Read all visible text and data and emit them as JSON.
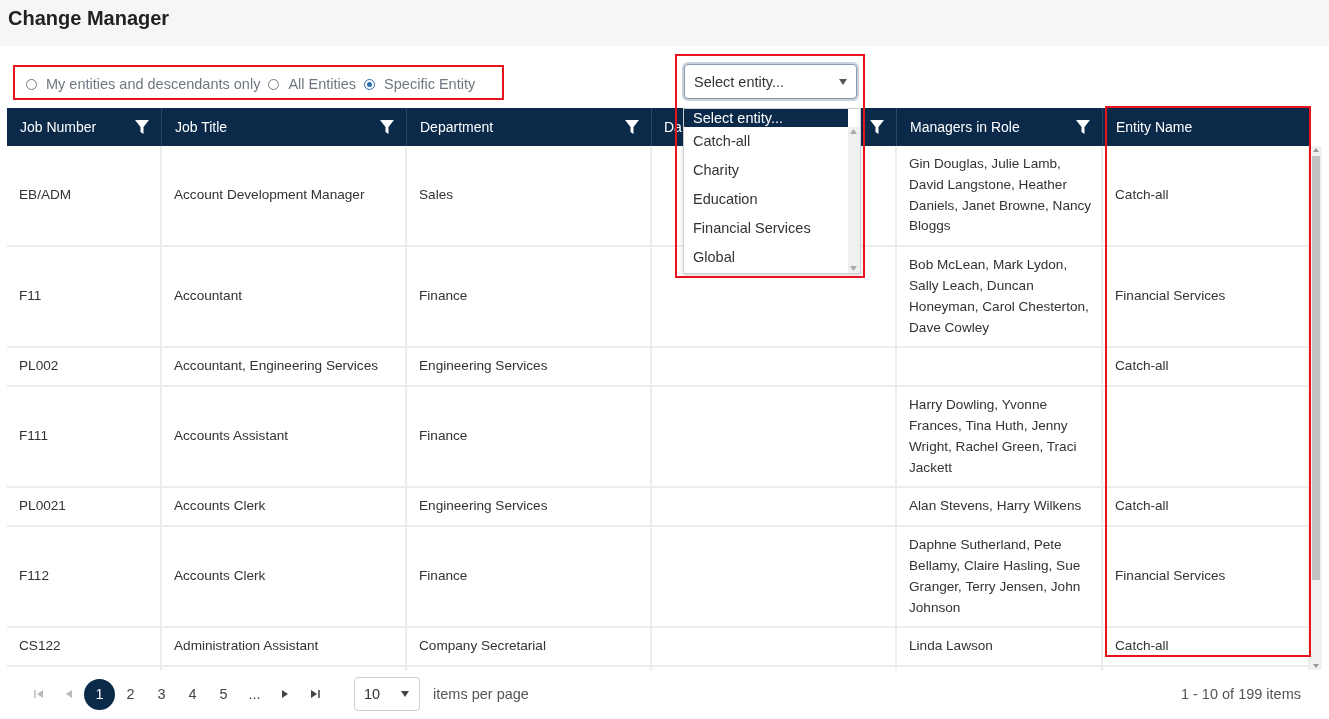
{
  "title": "Change Manager",
  "scope_options": [
    {
      "label": "My entities and descendants only",
      "selected": false
    },
    {
      "label": "All Entities",
      "selected": false
    },
    {
      "label": "Specific Entity",
      "selected": true
    }
  ],
  "entity_select": {
    "value": "Select entity...",
    "expanded": true,
    "options": [
      {
        "label": "Select entity...",
        "selected": true
      },
      {
        "label": "Catch-all",
        "selected": false
      },
      {
        "label": "Charity",
        "selected": false
      },
      {
        "label": "Education",
        "selected": false
      },
      {
        "label": "Financial Services",
        "selected": false
      },
      {
        "label": "Global",
        "selected": false
      }
    ]
  },
  "table": {
    "columns": [
      {
        "label": "Job Number",
        "filter": true
      },
      {
        "label": "Job Title",
        "filter": true
      },
      {
        "label": "Department",
        "filter": true
      },
      {
        "label": "Da",
        "filter": true
      },
      {
        "label": "Managers in Role",
        "filter": true
      },
      {
        "label": "Entity Name",
        "filter": false
      }
    ],
    "rows": [
      {
        "job_number": "EB/ADM",
        "job_title": "Account Development Manager",
        "department": "Sales",
        "managers_in_role": "Gin Douglas, Julie Lamb, David Langstone, Heather Daniels, Janet Browne, Nancy Bloggs",
        "entity_name": "Catch-all"
      },
      {
        "job_number": "F11",
        "job_title": "Accountant",
        "department": "Finance",
        "managers_in_role": "Bob McLean, Mark Lydon, Sally Leach, Duncan Honeyman, Carol Chesterton, Dave Cowley",
        "entity_name": "Financial Services"
      },
      {
        "job_number": "PL002",
        "job_title": "Accountant, Engineering Services",
        "department": "Engineering Services",
        "entity_name": "Catch-all"
      },
      {
        "job_number": "F111",
        "job_title": "Accounts Assistant",
        "department": "Finance",
        "managers_in_role": "Harry Dowling, Yvonne Frances, Tina Huth, Jenny Wright, Rachel Green, Traci Jackett"
      },
      {
        "job_number": "PL0021",
        "job_title": "Accounts Clerk",
        "department": "Engineering Services",
        "managers_in_role": "Alan Stevens, Harry Wilkens",
        "entity_name": "Catch-all"
      },
      {
        "job_number": "F112",
        "job_title": "Accounts Clerk",
        "department": "Finance",
        "managers_in_role": "Daphne Sutherland, Pete Bellamy, Claire Hasling, Sue Granger, Terry Jensen, John Johnson",
        "entity_name": "Financial Services"
      },
      {
        "job_number": "CS122",
        "job_title": "Administration Assistant",
        "department": "Company Secretarial",
        "managers_in_role": "Linda Lawson",
        "entity_name": "Catch-all"
      }
    ]
  },
  "pagination": {
    "pages": [
      {
        "label": "1",
        "selected": true
      },
      {
        "label": "2",
        "selected": false
      },
      {
        "label": "3",
        "selected": false
      },
      {
        "label": "4",
        "selected": false
      },
      {
        "label": "5",
        "selected": false
      },
      {
        "label": "...",
        "selected": false
      }
    ],
    "page_size": "10",
    "page_size_label": "items per page",
    "summary": "1 - 10 of 199 items"
  },
  "annotation_frames": [
    {
      "kind": "scope"
    },
    {
      "kind": "dropdown"
    },
    {
      "kind": "entity_column"
    }
  ]
}
